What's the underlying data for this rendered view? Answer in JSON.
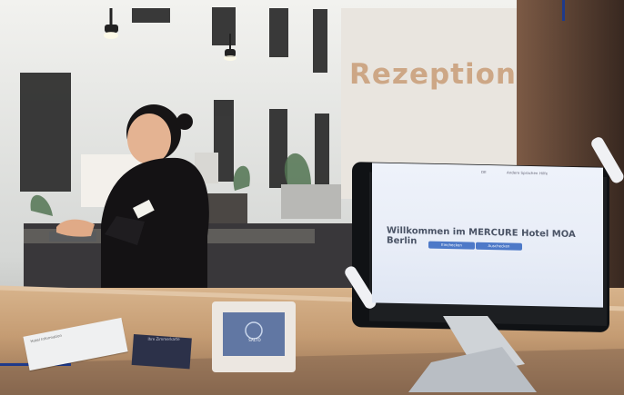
{
  "sign_text": "Rezeption",
  "kiosk": {
    "headline": "Willkommen im MERCURE Hotel MOA Berlin",
    "top_bar": [
      "DE",
      "Andere Sprachen",
      "Hilfe"
    ],
    "buttons": [
      "Einchecken",
      "Auschecken"
    ]
  },
  "card_holder_text": "Ihre Zimmerkarte",
  "reader_brand": "SALTO",
  "paper_text": "Hotel Information",
  "colors": {
    "frame": "#1f3a8a",
    "wall": "#dfe2e2",
    "counter": "#c5a07a",
    "screen_blue": "#4d79c8",
    "sign": "#c79a73"
  }
}
